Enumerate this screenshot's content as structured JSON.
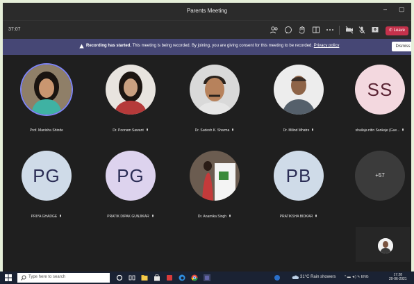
{
  "window": {
    "title": "Parents Meeting",
    "minimize": "–",
    "maximize": "▢"
  },
  "toolbar": {
    "timer": "37:07",
    "leave_label": "Leave"
  },
  "banner": {
    "bold": "Recording has started.",
    "message": "This meeting is being recorded. By joining, you are giving consent for this meeting to be recorded.",
    "link": "Privacy policy",
    "dismiss": "Dismiss"
  },
  "participants": [
    {
      "name": "Prof. Manisha Shinde",
      "initials": ""
    },
    {
      "name": "Dr. Poonam Sawant",
      "initials": ""
    },
    {
      "name": "Dr. Sudesh K. Sharma",
      "initials": ""
    },
    {
      "name": "Dr. Milind Mhatre",
      "initials": ""
    },
    {
      "name": "shailaja nitin Sankaje (Gue...",
      "initials": "SS"
    },
    {
      "name": "PRIYA GHADGE",
      "initials": "PG"
    },
    {
      "name": "PRATIK DIPAK GUNJIKAR",
      "initials": "PG"
    },
    {
      "name": "Dr. Anamika Singh",
      "initials": ""
    },
    {
      "name": "PRATIKSHA BIDKAR",
      "initials": "PB"
    },
    {
      "name": "",
      "initials": "+57"
    }
  ],
  "taskbar": {
    "search_placeholder": "Type here to search",
    "weather": "31°C  Rain showers",
    "lang": "ENG",
    "time": "17:28",
    "date": "20-06-2021"
  }
}
